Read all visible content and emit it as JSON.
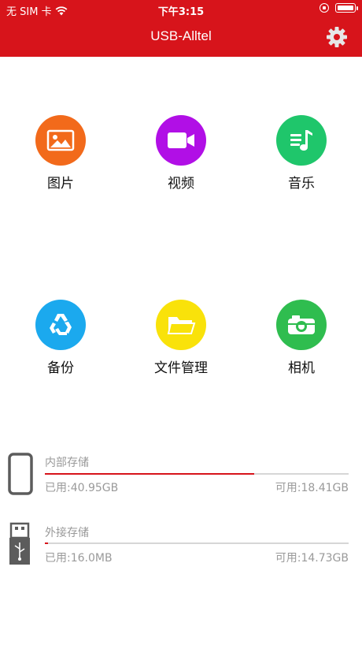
{
  "status_bar": {
    "carrier": "无 SIM 卡",
    "time": "下午3:15"
  },
  "header": {
    "title": "USB-Alltel"
  },
  "tiles": [
    {
      "label": "图片",
      "icon": "image-icon",
      "color": "#f26a1b"
    },
    {
      "label": "视频",
      "icon": "video-camera-icon",
      "color": "#b10fe6"
    },
    {
      "label": "音乐",
      "icon": "music-list-icon",
      "color": "#1fc66b"
    },
    {
      "label": "备份",
      "icon": "recycle-icon",
      "color": "#1ba9ee"
    },
    {
      "label": "文件管理",
      "icon": "folder-icon",
      "color": "#f9e20a"
    },
    {
      "label": "相机",
      "icon": "camera-icon",
      "color": "#2fbd4f"
    }
  ],
  "storage": {
    "internal": {
      "label": "内部存储",
      "used": "已用:40.95GB",
      "available": "可用:18.41GB",
      "used_fraction": 0.69
    },
    "external": {
      "label": "外接存储",
      "used": "已用:16.0MB",
      "available": "可用:14.73GB",
      "used_fraction": 0.01
    }
  },
  "colors": {
    "accent": "#d7141b"
  }
}
